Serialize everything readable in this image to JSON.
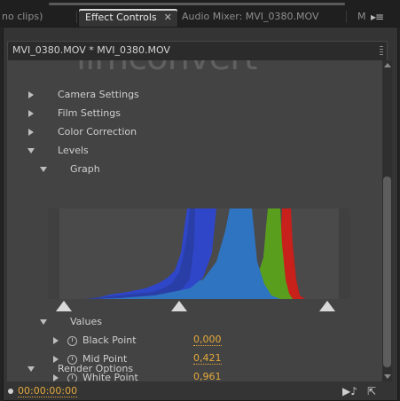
{
  "tabs": [
    {
      "label": "no clips)",
      "active": false
    },
    {
      "label": "Effect Controls",
      "active": true,
      "close": "✕"
    },
    {
      "label": "Audio Mixer: MVI_0380.MOV",
      "active": false
    },
    {
      "label": "M",
      "active": false
    }
  ],
  "panel_menu_glyph": "▸≡",
  "clip_header": "MVI_0380.MOV * MVI_0380.MOV",
  "watermark_text": "ilmconvert",
  "effects": {
    "camera_settings": "Camera Settings",
    "film_settings": "Film Settings",
    "color_correction": "Color Correction",
    "levels": "Levels",
    "graph": "Graph",
    "values": "Values",
    "render_options": "Render Options"
  },
  "params": [
    {
      "label": "Black Point",
      "value": "0,000"
    },
    {
      "label": "Mid Point",
      "value": "0,421"
    },
    {
      "label": "White Point",
      "value": "0,961"
    }
  ],
  "level_handles": {
    "black": 0.0,
    "mid": 0.421,
    "white": 0.961
  },
  "histogram_colors": {
    "blue": "#2f46c8",
    "light_blue": "#2f74c0",
    "green": "#5a9e1e",
    "red": "#c8201a"
  },
  "timecode": "00:00:00:00",
  "status_icons": [
    "play-audio-icon",
    "export-icon"
  ],
  "accent_color": "#e4a93b"
}
